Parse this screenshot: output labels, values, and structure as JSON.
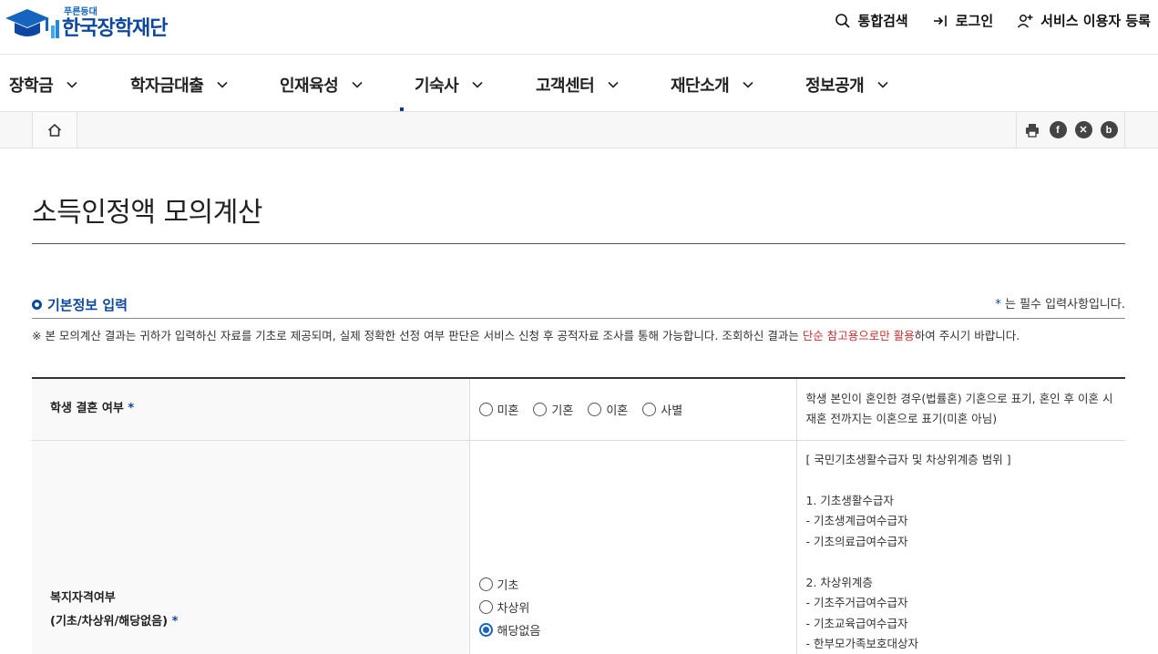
{
  "header": {
    "logo_small": "푸른등대",
    "logo_main": "한국장학재단",
    "utils": [
      {
        "label": "통합검색",
        "icon": "search-icon"
      },
      {
        "label": "로그인",
        "icon": "login-icon"
      },
      {
        "label": "서비스 이용자 등록",
        "icon": "user-add-icon"
      }
    ]
  },
  "gnb": {
    "items": [
      {
        "label": "장학금"
      },
      {
        "label": "학자금대출"
      },
      {
        "label": "인재육성"
      },
      {
        "label": "기숙사"
      },
      {
        "label": "고객센터"
      },
      {
        "label": "재단소개"
      },
      {
        "label": "정보공개"
      }
    ]
  },
  "share": {
    "icons": [
      "print-icon",
      "facebook-icon",
      "x-icon",
      "blog-icon"
    ]
  },
  "page": {
    "title": "소득인정액 모의계산"
  },
  "section": {
    "title": "기본정보 입력",
    "required_star": "*",
    "required_note": " 는 필수 입력사항입니다.",
    "notice_prefix": "※ 본 모의계산 결과는 귀하가 입력하신 자료를 기초로 제공되며, 실제 정확한 선정 여부 판단은 서비스 신청 후 공적자료 조사를 통해 가능합니다. 조회하신 결과는 ",
    "notice_highlight": "단순 참고용으로만 활용",
    "notice_suffix": "하여 주시기 바랍니다."
  },
  "form": {
    "marriage": {
      "label": "학생 결혼 여부",
      "star": "*",
      "options": [
        "미혼",
        "기혼",
        "이혼",
        "사별"
      ],
      "selected": "",
      "desc": "학생 본인이 혼인한 경우(법률혼) 기혼으로 표기, 혼인 후 이혼 시 재혼 전까지는 이혼으로 표기(미혼 아님)"
    },
    "welfare": {
      "label_line1": "복지자격여부",
      "label_line2": "(기초/차상위/해당없음)",
      "star": "*",
      "options": [
        "기초",
        "차상위",
        "해당없음"
      ],
      "selected": "해당없음",
      "desc_lines": [
        "[ 국민기초생활수급자 및 차상위계층 범위 ]",
        "",
        "1. 기초생활수급자",
        "- 기초생계급여수급자",
        "- 기초의료급여수급자",
        "",
        "2. 차상위계층",
        "- 기초주거급여수급자",
        "- 기초교육급여수급자",
        "- 한부모가족보호대상자"
      ]
    }
  },
  "colors": {
    "brand": "#0d47a1",
    "highlight": "#d32f2f"
  }
}
